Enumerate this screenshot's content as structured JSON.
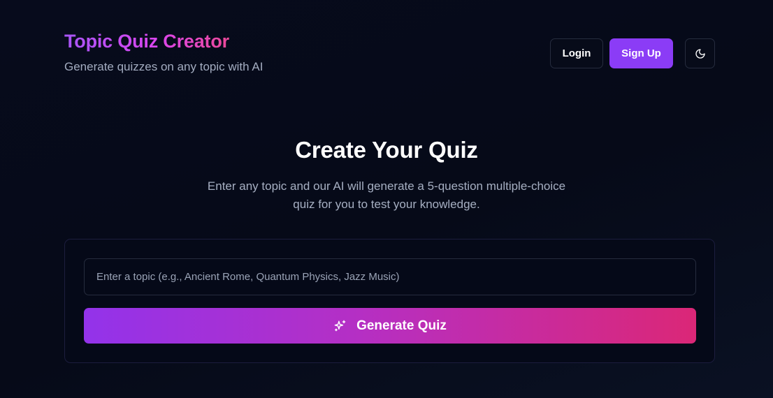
{
  "header": {
    "title": "Topic Quiz Creator",
    "subtitle": "Generate quizzes on any topic with AI",
    "login_label": "Login",
    "signup_label": "Sign Up",
    "theme_toggle_icon": "moon-icon"
  },
  "hero": {
    "title": "Create Your Quiz",
    "description": "Enter any topic and our AI will generate a 5-question multiple-choice quiz for you to test your knowledge."
  },
  "form": {
    "topic_placeholder": "Enter a topic (e.g., Ancient Rome, Quantum Physics, Jazz Music)",
    "topic_value": "",
    "generate_label": "Generate Quiz",
    "generate_icon": "sparkles-icon"
  },
  "colors": {
    "accent": "#8b3cf6",
    "gradient_start": "#9333ea",
    "gradient_end": "#db2777",
    "background": "#060a1a"
  }
}
